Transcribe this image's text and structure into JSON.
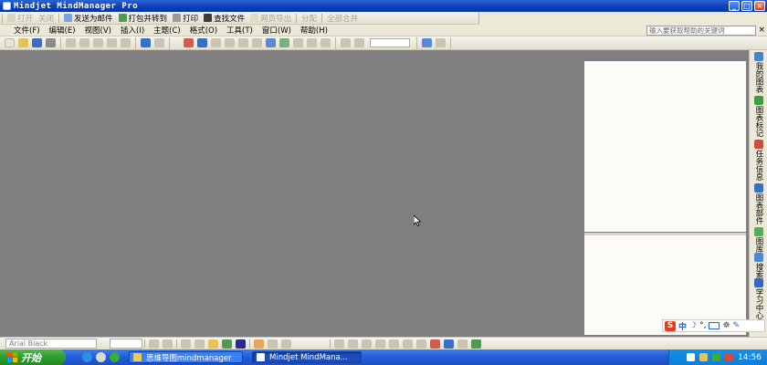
{
  "window": {
    "title": "Mindjet MindManager Pro",
    "controls": [
      "_",
      "□",
      "×"
    ]
  },
  "toolbar1": {
    "items": [
      {
        "label": "打开",
        "disabled": true
      },
      {
        "label": "关闭",
        "disabled": true
      },
      {
        "label": "发送为邮件",
        "disabled": false
      },
      {
        "label": "打包并转到",
        "disabled": false
      },
      {
        "label": "打印",
        "disabled": false
      },
      {
        "label": "查找文件",
        "disabled": false
      },
      {
        "label": "网页导出",
        "disabled": true
      },
      {
        "label": "分配",
        "disabled": true
      },
      {
        "label": "全部合并",
        "disabled": true
      }
    ]
  },
  "menubar": {
    "items": [
      "文件(F)",
      "编辑(E)",
      "视图(V)",
      "插入(I)",
      "主题(C)",
      "格式(O)",
      "工具(T)",
      "窗口(W)",
      "帮助(H)"
    ],
    "help_placeholder": "输入要获取帮助的关键词",
    "help_close": "×"
  },
  "side_tabs": [
    {
      "label": "我的图表",
      "icon": "my-maps-icon",
      "color": "#4a7fd6"
    },
    {
      "label": "图表标记",
      "icon": "map-markers-icon",
      "color": "#3f9f3f"
    },
    {
      "label": "任务信息",
      "icon": "task-info-icon",
      "color": "#d64a3a"
    },
    {
      "label": "图表部件",
      "icon": "map-parts-icon",
      "color": "#3a6fc8"
    },
    {
      "label": "图库",
      "icon": "library-icon",
      "color": "#5aa85a"
    },
    {
      "label": "搜索",
      "icon": "search-icon",
      "color": "#4a8ad6"
    },
    {
      "label": "学习中心",
      "icon": "learning-center-icon",
      "color": "#2e6ac4"
    }
  ],
  "ime": {
    "logo": "S",
    "mode": "中",
    "punct": "°,"
  },
  "format_bar": {
    "font": "Arial Black",
    "size": ""
  },
  "taskbar": {
    "start_label": "开始",
    "tasks": [
      {
        "label": "思维导图mindmanager",
        "active": false
      },
      {
        "label": "Mindjet MindMana...",
        "active": true
      }
    ],
    "clock": "14:56"
  }
}
